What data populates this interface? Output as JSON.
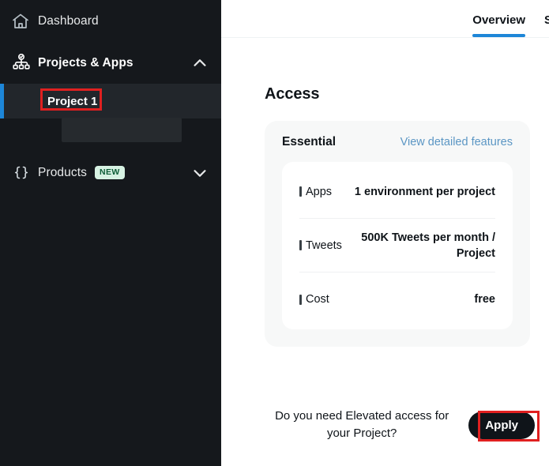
{
  "sidebar": {
    "items": [
      {
        "label": "Dashboard",
        "icon": "home-icon",
        "expandable": false
      },
      {
        "label": "Projects & Apps",
        "icon": "org-chart-icon",
        "expandable": true,
        "chevron": "chevron-up-icon"
      },
      {
        "label": "Products",
        "icon": "curly-braces-icon",
        "expandable": true,
        "chevron": "chevron-down-icon",
        "badge": "NEW"
      }
    ],
    "selected_project": "Project 1",
    "accent_color": "#1d86d8",
    "background_color": "#15181c",
    "badge_bg": "#d7f2e3",
    "badge_fg": "#0c5c36"
  },
  "tabs": [
    {
      "label": "Overview",
      "active": true
    },
    {
      "label": "S",
      "active": false
    }
  ],
  "main": {
    "section_title": "Access",
    "panel": {
      "tier": "Essential",
      "details_link": "View detailed features",
      "features": [
        {
          "label": "Apps",
          "value": "1 environment per project"
        },
        {
          "label": "Tweets",
          "value": "500K Tweets per month / Project"
        },
        {
          "label": "Cost",
          "value": "free"
        }
      ]
    },
    "elevated": {
      "question": "Do you need Elevated access for your Project?",
      "apply_label": "Apply"
    }
  },
  "annotations": {
    "color": "#e02020",
    "targets": [
      "Project 1",
      "Apply"
    ]
  }
}
